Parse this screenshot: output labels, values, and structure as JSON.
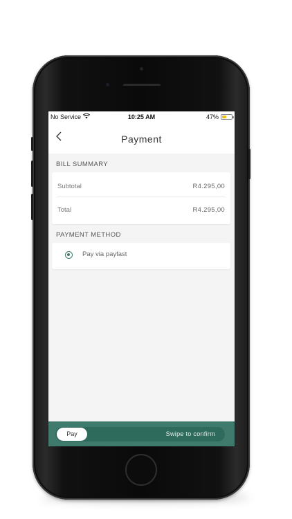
{
  "status_bar": {
    "carrier": "No Service",
    "time": "10:25 AM",
    "battery": "47%",
    "battery_level": 0.47,
    "battery_color": "#f2c21b"
  },
  "header": {
    "title": "Payment",
    "back_icon": "chevron-left-icon"
  },
  "bill_summary": {
    "label": "BILL SUMMARY",
    "rows": [
      {
        "label": "Subtotal",
        "value": "R4.295,00"
      },
      {
        "label": "Total",
        "value": "R4.295,00"
      }
    ]
  },
  "payment_method": {
    "label": "PAYMENT METHOD",
    "options": [
      {
        "label": "Pay via payfast",
        "selected": true
      }
    ]
  },
  "footer": {
    "pay_label": "Pay",
    "hint": "Swipe to confirm"
  },
  "colors": {
    "accent": "#3f7a6c",
    "background": "#f4f4f4"
  }
}
